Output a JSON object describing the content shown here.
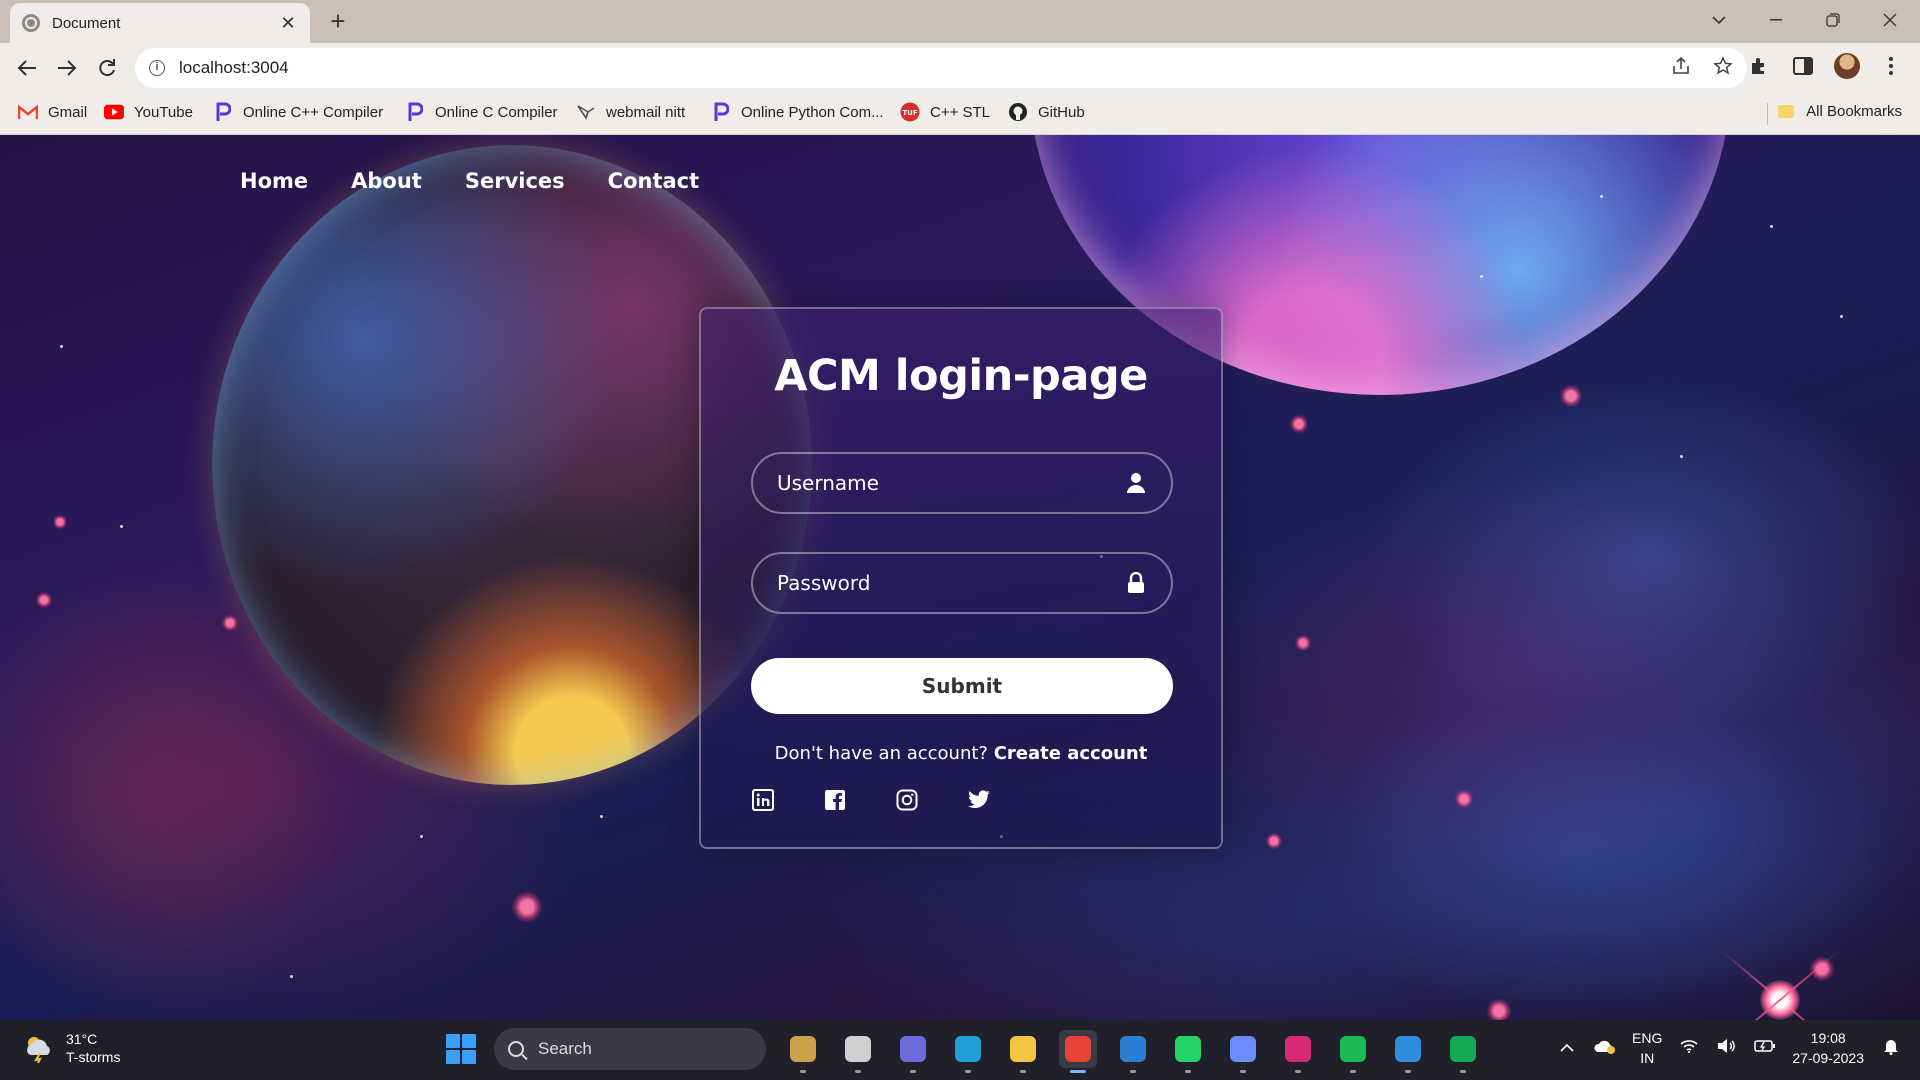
{
  "browser": {
    "tab_title": "Document",
    "tab_close": "✕",
    "new_tab": "+",
    "url": "localhost:3004",
    "info_glyph": "i",
    "bookmarks": [
      {
        "label": "Gmail",
        "icon": "gmail-icon",
        "glyph": "M",
        "color": "#ea4335"
      },
      {
        "label": "YouTube",
        "icon": "youtube-icon",
        "glyph": "▶",
        "color": "#ff0000"
      },
      {
        "label": "Online C++ Compiler",
        "icon": "programiz-icon",
        "glyph": "P",
        "color": "#5b35d5"
      },
      {
        "label": "Online C Compiler",
        "icon": "programiz-icon",
        "glyph": "P",
        "color": "#5b35d5"
      },
      {
        "label": "webmail nitt",
        "icon": "webmail-icon",
        "glyph": "✉",
        "color": "#555555"
      },
      {
        "label": "Online Python Com...",
        "icon": "programiz-icon",
        "glyph": "P",
        "color": "#5b35d5"
      },
      {
        "label": "C++ STL",
        "icon": "gfg-icon",
        "glyph": "●",
        "color": "#d32f2f"
      },
      {
        "label": "GitHub",
        "icon": "github-icon",
        "glyph": "●",
        "color": "#222222"
      }
    ],
    "all_bookmarks": "All Bookmarks"
  },
  "page": {
    "nav": [
      "Home",
      "About",
      "Services",
      "Contact"
    ],
    "title": "ACM login-page",
    "username_placeholder": "Username",
    "password_placeholder": "Password",
    "submit_label": "Submit",
    "register_text": "Don't have an account?",
    "register_link": "Create account",
    "socials": [
      "linkedin-icon",
      "facebook-icon",
      "instagram-icon",
      "twitter-icon"
    ]
  },
  "taskbar": {
    "weather_temp": "31°C",
    "weather_desc": "T-storms",
    "search_label": "Search",
    "language": "ENG",
    "region": "IN",
    "time": "19:08",
    "date": "27-09-2023",
    "apps": [
      {
        "name": "widgets-app-icon",
        "color": "#c9a24a",
        "active": false
      },
      {
        "name": "task-view-icon",
        "color": "#cfcfcf",
        "active": false
      },
      {
        "name": "teams-meet-icon",
        "color": "#6b6bdb",
        "active": false
      },
      {
        "name": "edge-icon",
        "color": "#1fa0d8",
        "active": false
      },
      {
        "name": "file-explorer-icon",
        "color": "#f4c542",
        "active": false
      },
      {
        "name": "chrome-icon",
        "color": "#e54335",
        "active": true
      },
      {
        "name": "mail-icon",
        "color": "#2a7fd4",
        "active": false
      },
      {
        "name": "whatsapp-icon",
        "color": "#25d366",
        "active": false
      },
      {
        "name": "messenger-icon",
        "color": "#6b8bff",
        "active": false
      },
      {
        "name": "instagram-app-icon",
        "color": "#d62976",
        "active": false
      },
      {
        "name": "spotify-icon",
        "color": "#1db954",
        "active": false
      },
      {
        "name": "vscode-icon",
        "color": "#2f8fdd",
        "active": false
      },
      {
        "name": "mongodb-compass-icon",
        "color": "#13aa52",
        "active": false
      }
    ]
  }
}
